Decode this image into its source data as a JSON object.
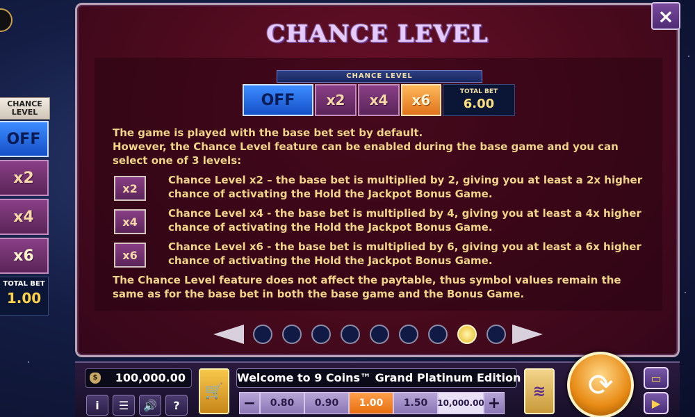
{
  "side_panel": {
    "header": "CHANCE LEVEL",
    "buttons": [
      "OFF",
      "x2",
      "x4",
      "x6"
    ],
    "total_bet_label": "TOTAL BET",
    "total_bet_value": "1.00"
  },
  "dialog": {
    "title": "CHANCE LEVEL",
    "close_icon": "×",
    "selector": {
      "header": "CHANCE LEVEL",
      "options": [
        "OFF",
        "x2",
        "x4",
        "x6"
      ],
      "selected": "x6",
      "total_bet_label": "TOTAL BET",
      "total_bet_value": "6.00"
    },
    "intro_lines": [
      "The game is played with the base bet set by default.",
      "However, the Chance Level feature can be enabled during the base game and you can select one of 3 levels:"
    ],
    "levels": [
      {
        "icon": "x2",
        "text": "Chance Level x2 – the base bet is multiplied by 2, giving you at least a 2x higher chance of activating the Hold the Jackpot Bonus Game."
      },
      {
        "icon": "x4",
        "text": "Chance Level x4 - the base bet is multiplied by 4, giving you at least a 4x higher chance of activating the Hold the Jackpot Bonus Game."
      },
      {
        "icon": "x6",
        "text": "Chance Level x6 - the base bet is multiplied by 6, giving you at least a 6x higher chance of activating the Hold the Jackpot Bonus Game."
      }
    ],
    "outro": "The Chance Level feature does not affect the paytable, thus symbol values remain the same as for the base bet in both the base game and the Bonus Game.",
    "pager": {
      "total_pages": 9,
      "current_page": 8
    }
  },
  "bottom_bar": {
    "balance": "100,000.00",
    "ticker": "Welcome to 9 Coins™ Grand Platinum Edition",
    "info_icon": "i",
    "menu_icon": "☰",
    "sound_icon": "🔊",
    "help_icon": "?",
    "bet_minus": "−",
    "bet_plus": "+",
    "bet_options": [
      "0.80",
      "0.90",
      "1.00",
      "1.50",
      "10,000.00"
    ],
    "selected_bet": "1.00"
  },
  "colors": {
    "accent_blue": "#1550c8",
    "accent_orange": "#e86e10",
    "text_gold": "#f0d48a",
    "dialog_bg": "#4a0a1d"
  }
}
